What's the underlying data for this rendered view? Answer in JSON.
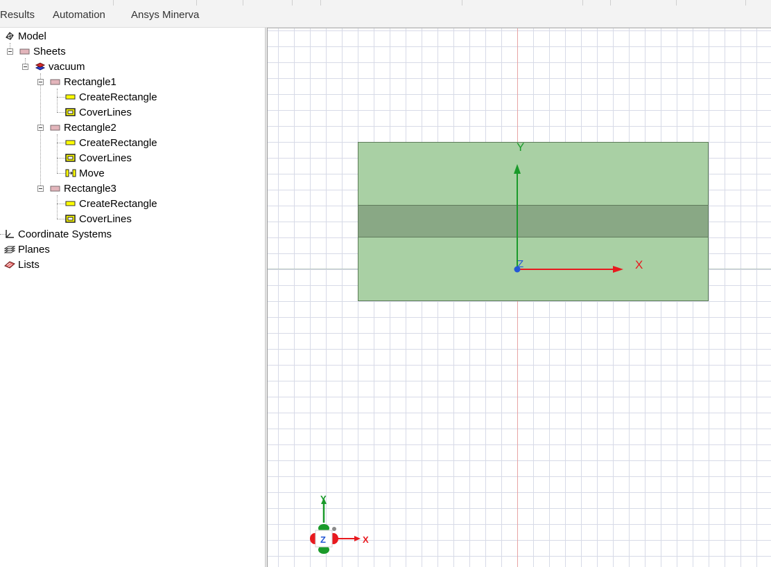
{
  "menu": {
    "items": [
      "Results",
      "Automation",
      "Ansys Minerva"
    ]
  },
  "tree": {
    "root_label": "Model",
    "sheets_label": "Sheets",
    "material_label": "vacuum",
    "objects": [
      {
        "label": "Rectangle1",
        "ops": [
          "CreateRectangle",
          "CoverLines"
        ]
      },
      {
        "label": "Rectangle2",
        "ops": [
          "CreateRectangle",
          "CoverLines",
          "Move"
        ]
      },
      {
        "label": "Rectangle3",
        "ops": [
          "CreateRectangle",
          "CoverLines"
        ]
      }
    ],
    "coord_label": "Coordinate Systems",
    "planes_label": "Planes",
    "lists_label": "Lists"
  },
  "viewport": {
    "axis_x_label": "X",
    "axis_y_label": "Y",
    "axis_z_label": "Z",
    "triad": {
      "x": "X",
      "y": "Y",
      "z": "Z"
    },
    "colors": {
      "x_axis": "#e8191e",
      "y_axis": "#1a9a2a",
      "z_axis": "#2457d6",
      "rectangle_fill": "#a9d0a4",
      "overlap_fill": "#89a885",
      "grid": "#d7dae7"
    }
  }
}
